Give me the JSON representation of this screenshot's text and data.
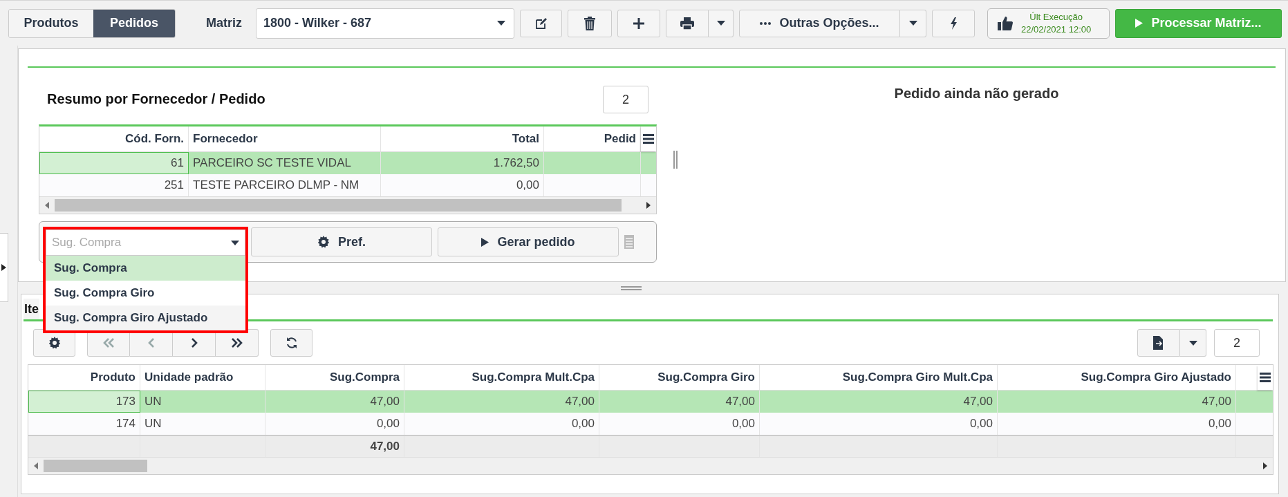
{
  "top_tabs": [
    {
      "label": "Produtos",
      "selected": false
    },
    {
      "label": "Pedidos",
      "selected": true
    }
  ],
  "matriz": {
    "label": "Matriz",
    "value": "1800 - Wilker - 687"
  },
  "toolbar": {
    "more_options": "Outras Opções...",
    "last_execution": {
      "label": "Últ Execução",
      "value": "22/02/2021 12:00"
    },
    "process_button": "Processar Matriz..."
  },
  "summary": {
    "title": "Resumo por Fornecedor / Pedido",
    "count": "2",
    "columns": [
      "Cód. Forn.",
      "Fornecedor",
      "Total",
      "Pedid"
    ],
    "rows": [
      {
        "cells": [
          "61",
          "PARCEIRO SC TESTE VIDAL",
          "1.762,50"
        ],
        "selected": true
      },
      {
        "cells": [
          "251",
          "TESTE PARCEIRO DLMP - NM",
          "0,00"
        ],
        "selected": false
      }
    ]
  },
  "suggestion_select": {
    "placeholder": "Sug. Compra",
    "expanded": true,
    "options": [
      {
        "label": "Sug. Compra",
        "selected": true
      },
      {
        "label": "Sug. Compra Giro",
        "selected": false
      },
      {
        "label": "Sug. Compra Giro Ajustado",
        "selected": false
      }
    ]
  },
  "pref_button": "Pref.",
  "generate_button": "Gerar pedido",
  "order_status": "Pedido ainda não gerado",
  "items": {
    "tab": "Ite",
    "count": "2",
    "columns": [
      "Produto",
      "Unidade padrão",
      "Sug.Compra",
      "Sug.Compra Mult.Cpa",
      "Sug.Compra Giro",
      "Sug.Compra Giro Mult.Cpa",
      "Sug.Compra Giro Ajustado"
    ],
    "rows": [
      {
        "cells": [
          "173",
          "UN",
          "47,00",
          "47,00",
          "47,00",
          "47,00",
          "47,00"
        ],
        "selected": true
      },
      {
        "cells": [
          "174",
          "UN",
          "0,00",
          "0,00",
          "0,00",
          "0,00",
          "0,00"
        ],
        "selected": false
      }
    ],
    "total_row": {
      "column_3": "47,00"
    }
  }
}
